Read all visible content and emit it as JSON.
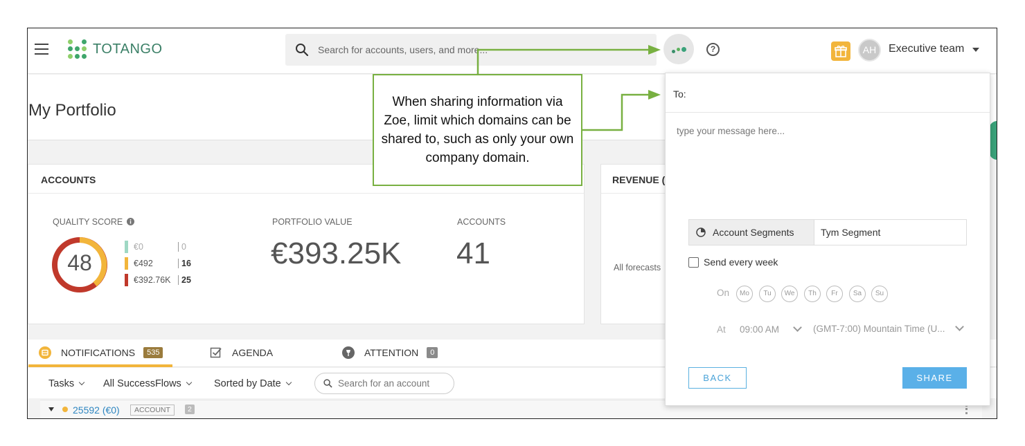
{
  "header": {
    "logo_text": "TOTANGO",
    "search_placeholder": "Search for accounts, users, and more...",
    "help_symbol": "?",
    "avatar_initials": "AH",
    "team_label": "Executive team"
  },
  "page": {
    "title": "My Portfolio"
  },
  "accounts_card": {
    "title": "ACCOUNTS",
    "quality_label": "QUALITY SCORE",
    "quality_score": "48",
    "legend": [
      {
        "value": "€0",
        "count": "0",
        "color": "#9fd8c4"
      },
      {
        "value": "€492",
        "count": "16",
        "color": "#f2b53b"
      },
      {
        "value": "€392.76K",
        "count": "25",
        "color": "#c0392b"
      }
    ],
    "portfolio_label": "PORTFOLIO VALUE",
    "portfolio_value": "€393.25K",
    "accounts_label": "ACCOUNTS",
    "accounts_value": "41"
  },
  "revenue_card": {
    "title": "REVENUE (",
    "forecast_text": "All forecasts"
  },
  "tabs": {
    "notifications": {
      "label": "NOTIFICATIONS",
      "count": "535"
    },
    "agenda": {
      "label": "AGENDA"
    },
    "attention": {
      "label": "ATTENTION",
      "count": "0"
    }
  },
  "filters": {
    "tasks": "Tasks",
    "flows": "All SuccessFlows",
    "sort": "Sorted by Date",
    "search_placeholder": "Search for an account"
  },
  "list": {
    "account": "25592 (€0)",
    "tag": "ACCOUNT",
    "count": "2"
  },
  "share_panel": {
    "to_label": "To:",
    "message_placeholder": "type your message here...",
    "segment_label": "Account Segments",
    "segment_value": "Tym Segment",
    "send_weekly": "Send every week",
    "on_label": "On",
    "days": [
      "Mo",
      "Tu",
      "We",
      "Th",
      "Fr",
      "Sa",
      "Su"
    ],
    "at_label": "At",
    "time": "09:00 AM",
    "timezone": "(GMT-7:00) Mountain Time (U...",
    "back": "BACK",
    "share": "SHARE"
  },
  "annotation": {
    "text": "When sharing information via Zoe, limit which domains can be shared to, such as only your own company domain."
  },
  "colors": {
    "brand_green": "#3a7f66",
    "callout_border": "#78b041",
    "notification_accent": "#f2b53b",
    "link_blue": "#2e86c1",
    "share_blue": "#5ab0e8"
  }
}
